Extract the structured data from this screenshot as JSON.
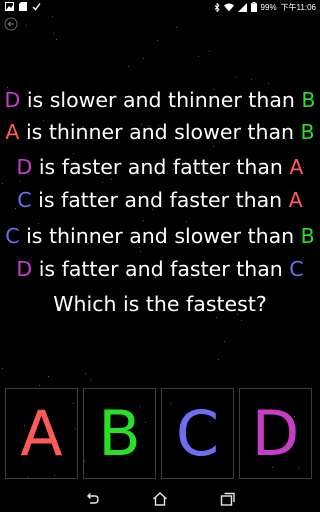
{
  "status_bar": {
    "battery": "99%",
    "time": "下午11:06"
  },
  "colors": {
    "A": "#ff5a5a",
    "B": "#28e028",
    "C": "#6e6ef0",
    "D": "#c83cc8",
    "text": "#ffffff",
    "background": "#000000",
    "button_border": "#3d3d3d"
  },
  "statements": [
    {
      "subject": "D",
      "text": " is slower and thinner than ",
      "object": "B"
    },
    {
      "subject": "A",
      "text": " is thinner and slower than ",
      "object": "B"
    },
    {
      "subject": "D",
      "text": " is faster and fatter than ",
      "object": "A"
    },
    {
      "subject": "C",
      "text": " is fatter and faster than ",
      "object": "A"
    },
    {
      "subject": "C",
      "text": " is thinner and slower than ",
      "object": "B"
    },
    {
      "subject": "D",
      "text": " is fatter and faster than ",
      "object": "C"
    }
  ],
  "question": "Which is the fastest?",
  "answers": [
    "A",
    "B",
    "C",
    "D"
  ],
  "icons": {
    "status_left": [
      "image-icon",
      "sd-card-icon",
      "check-icon"
    ],
    "status_right": [
      "bluetooth-icon",
      "wifi-icon",
      "signal-icon",
      "battery-icon"
    ],
    "back": "back-arrow-icon",
    "nav": [
      "nav-back-icon",
      "nav-home-icon",
      "nav-recents-icon"
    ]
  }
}
